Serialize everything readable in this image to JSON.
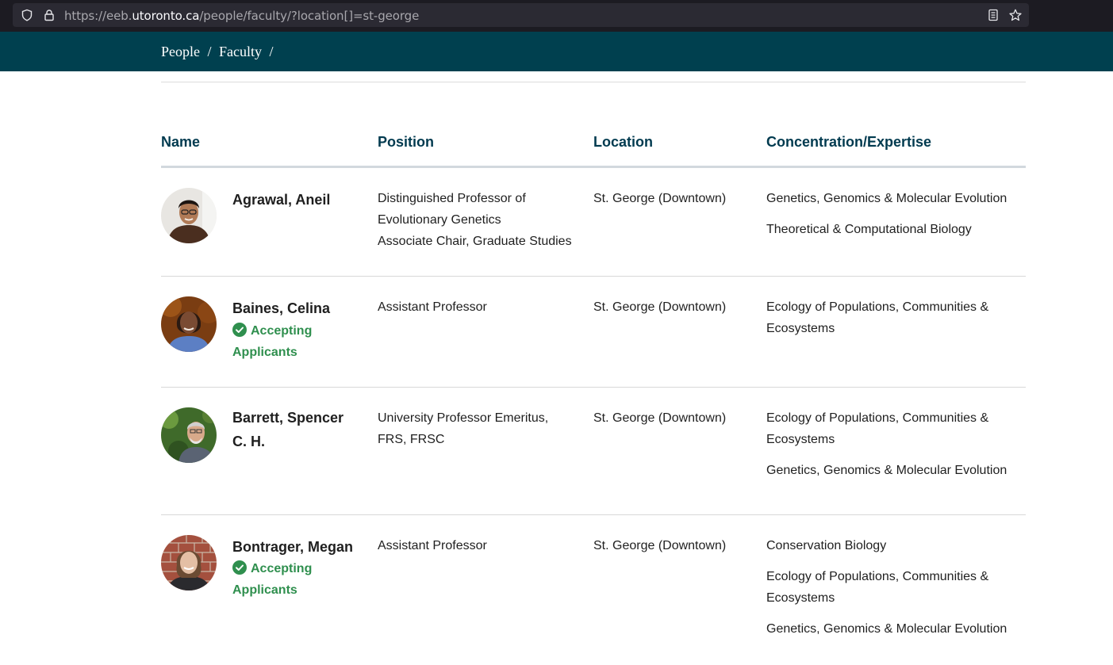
{
  "browser": {
    "url_prefix": "https://eeb.",
    "url_domain": "utoronto.ca",
    "url_suffix": "/people/faculty/?location[]=st-george"
  },
  "breadcrumb": {
    "items": [
      "People",
      "/",
      "Faculty",
      "/"
    ]
  },
  "table": {
    "headers": {
      "name": "Name",
      "position": "Position",
      "location": "Location",
      "concentration": "Concentration/Expertise"
    },
    "rows": [
      {
        "name": "Agrawal, Aneil",
        "accepting": "",
        "position": [
          "Distinguished Professor of",
          "Evolutionary Genetics",
          "Associate Chair, Graduate Studies"
        ],
        "location": "St. George (Downtown)",
        "concentration": [
          "Genetics, Genomics & Molecular Evolution",
          "Theoretical & Computational Biology"
        ]
      },
      {
        "name": "Baines, Celina",
        "accepting": "Accepting Applicants",
        "position": [
          "Assistant Professor"
        ],
        "location": "St. George (Downtown)",
        "concentration": [
          "Ecology of Populations, Communities & Ecosystems"
        ]
      },
      {
        "name": "Barrett, Spencer C. H.",
        "accepting": "",
        "position": [
          "University Professor Emeritus, FRS, FRSC"
        ],
        "location": "St. George (Downtown)",
        "concentration": [
          "Ecology of Populations, Communities & Ecosystems",
          "Genetics, Genomics & Molecular Evolution"
        ]
      },
      {
        "name": "Bontrager, Megan",
        "accepting": "Accepting Applicants",
        "position": [
          "Assistant Professor"
        ],
        "location": "St. George (Downtown)",
        "concentration": [
          "Conservation Biology",
          "Ecology of Populations, Communities & Ecosystems",
          "Genetics, Genomics & Molecular Evolution"
        ]
      }
    ]
  },
  "icons": {
    "shield": "shield-icon",
    "lock": "lock-icon",
    "reader": "reader-view-icon",
    "star": "bookmark-star-icon",
    "check": "check-circle-icon"
  },
  "colors": {
    "header_bg": "#00404f",
    "heading_text": "#003a4f",
    "accepting": "#2f8f4e"
  }
}
